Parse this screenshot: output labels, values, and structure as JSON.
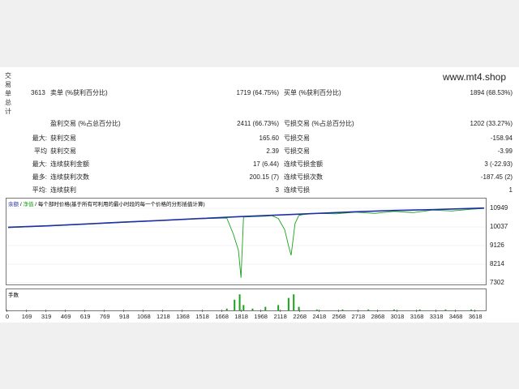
{
  "watermark": "www.mt4.shop",
  "sidebar_chars": [
    "交",
    "易",
    "单",
    "总",
    "计"
  ],
  "stats_left_top": [
    {
      "value": "3613",
      "label": "卖单 (%获利百分比)"
    }
  ],
  "stats_mid_top": [
    {
      "value": "1719 (64.75%)",
      "label": "买单 (%获利百分比)",
      "right": "1894 (68.53%)"
    }
  ],
  "stats_rows": [
    {
      "llabel": "",
      "mlabel": "盈利交易 (%占总百分比)",
      "mval": "2411 (66.73%)",
      "rlabel": "亏损交易 (%占总百分比)",
      "rval": "1202 (33.27%)"
    },
    {
      "llabel": "最大:",
      "mlabel": "获利交易",
      "mval": "165.60",
      "rlabel": "亏损交易",
      "rval": "-158.94"
    },
    {
      "llabel": "平均",
      "mlabel": "获利交易",
      "mval": "2.39",
      "rlabel": "亏损交易",
      "rval": "-3.99"
    },
    {
      "llabel": "最大:",
      "mlabel": "连续获利金额",
      "mval": "17 (6.44)",
      "rlabel": "连续亏损金额",
      "rval": "3 (-22.93)"
    },
    {
      "llabel": "最多:",
      "mlabel": "连续获利次数",
      "mval": "200.15 (7)",
      "rlabel": "连续亏损次数",
      "rval": "-187.45 (2)"
    },
    {
      "llabel": "平均:",
      "mlabel": "连续获利",
      "mval": "3",
      "rlabel": "连续亏损",
      "rval": "1"
    }
  ],
  "chart": {
    "title_parts": [
      "余额",
      "净值",
      "每个部时价格(基于所有可利用的最小时段的每一个价格的分形插值计算)"
    ],
    "title_text": "余额 / 净值 / 每个部时价格(基于所有可利用的最小时段的每一个价格的分形插值计算)",
    "volume_title": "手数",
    "colors": {
      "balance": "#1f2fa8",
      "equity": "#1aa21a",
      "volume": "#1aa21a"
    }
  },
  "chart_data": {
    "type": "line",
    "x_ticks": [
      "0",
      "169",
      "319",
      "469",
      "619",
      "769",
      "918",
      "1068",
      "1218",
      "1368",
      "1518",
      "1668",
      "1818",
      "1968",
      "2118",
      "2268",
      "2418",
      "2568",
      "2718",
      "2868",
      "3018",
      "3168",
      "3318",
      "3468",
      "3618"
    ],
    "y_ticks": [
      "10949",
      "10037",
      "9126",
      "8214",
      "7302"
    ],
    "ylim": [
      7302,
      10949
    ],
    "xlim": [
      0,
      3700
    ],
    "series": [
      {
        "name": "余额",
        "x": [
          0,
          300,
          600,
          900,
          1200,
          1500,
          1800,
          2100,
          2400,
          2700,
          3000,
          3300,
          3600,
          3700
        ],
        "values": [
          10020,
          10090,
          10180,
          10270,
          10360,
          10450,
          10540,
          10620,
          10700,
          10780,
          10840,
          10880,
          10940,
          10960
        ]
      },
      {
        "name": "净值",
        "x": [
          0,
          300,
          600,
          900,
          1200,
          1500,
          1700,
          1750,
          1790,
          1810,
          1830,
          1900,
          2000,
          2050,
          2100,
          2150,
          2180,
          2200,
          2230,
          2260,
          2300,
          2400,
          2550,
          2700,
          2850,
          3000,
          3150,
          3300,
          3450,
          3600,
          3700
        ],
        "values": [
          10000,
          10080,
          10170,
          10260,
          10350,
          10440,
          10470,
          9700,
          8900,
          7550,
          10520,
          10540,
          10560,
          10590,
          10450,
          9900,
          9100,
          8650,
          10200,
          10600,
          10650,
          10700,
          10680,
          10760,
          10700,
          10800,
          10740,
          10860,
          10820,
          10900,
          10940
        ]
      }
    ],
    "volume": {
      "x": [
        1700,
        1760,
        1800,
        1830,
        1900,
        2000,
        2100,
        2180,
        2220,
        2260,
        2400,
        2600,
        2800,
        3000,
        3200,
        3400,
        3600
      ],
      "values": [
        0.1,
        0.6,
        0.9,
        0.3,
        0.1,
        0.2,
        0.3,
        0.7,
        0.9,
        0.2,
        0.05,
        0.05,
        0.05,
        0.05,
        0.05,
        0.05,
        0.05
      ]
    }
  }
}
